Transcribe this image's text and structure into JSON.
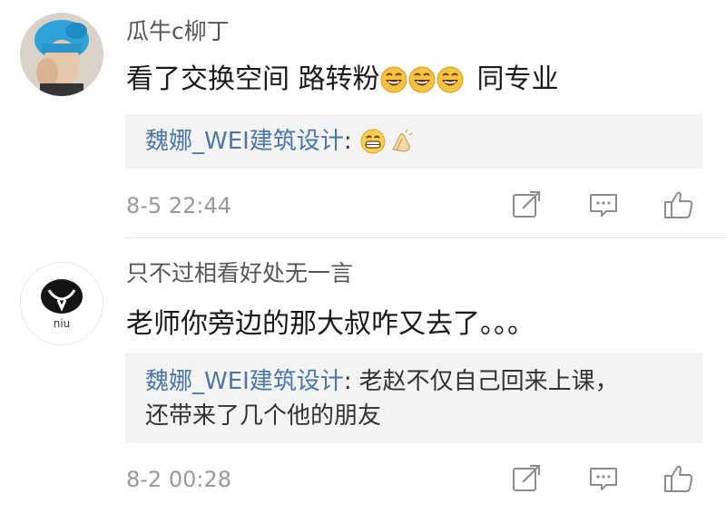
{
  "comments": [
    {
      "user": "瓜牛c柳丁",
      "text_before_emoji": "看了交换空间 路转粉",
      "emoji_names": [
        "laughing-emoji",
        "laughing-emoji",
        "laughing-emoji"
      ],
      "text_after_emoji": "同专业",
      "reply_author": "魏娜_WEI建筑设计",
      "reply_colon": ":",
      "reply_emoji_names": [
        "grin-emoji",
        "clap-emoji"
      ],
      "timestamp": "8-5 22:44",
      "avatar": "user-photo-blue-hair"
    },
    {
      "user": "只不过相看好处无一言",
      "text": "老师你旁边的那大叔咋又去了。。。",
      "reply_author": "魏娜_WEI建筑设计",
      "reply_colon": ":",
      "reply_text_line1": "老赵不仅自己回来上课，",
      "reply_text_line2": "还带来了几个他的朋友",
      "timestamp": "8-2 00:28",
      "avatar": "niu-logo",
      "avatar_text": "niu"
    }
  ],
  "icons": {
    "share": "share-icon",
    "comment": "comment-icon",
    "like": "thumbs-up-icon"
  },
  "colors": {
    "reply_author": "#4a76a8",
    "reply_background": "#f3f3f3",
    "timestamp": "#999999",
    "username": "#555555"
  }
}
